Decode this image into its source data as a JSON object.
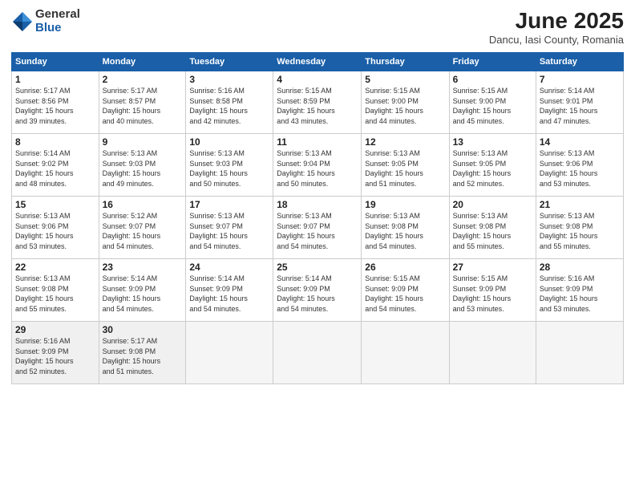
{
  "logo": {
    "general": "General",
    "blue": "Blue"
  },
  "title": "June 2025",
  "location": "Dancu, Iasi County, Romania",
  "weekdays": [
    "Sunday",
    "Monday",
    "Tuesday",
    "Wednesday",
    "Thursday",
    "Friday",
    "Saturday"
  ],
  "weeks": [
    [
      {
        "day": "1",
        "info": "Sunrise: 5:17 AM\nSunset: 8:56 PM\nDaylight: 15 hours\nand 39 minutes."
      },
      {
        "day": "2",
        "info": "Sunrise: 5:17 AM\nSunset: 8:57 PM\nDaylight: 15 hours\nand 40 minutes."
      },
      {
        "day": "3",
        "info": "Sunrise: 5:16 AM\nSunset: 8:58 PM\nDaylight: 15 hours\nand 42 minutes."
      },
      {
        "day": "4",
        "info": "Sunrise: 5:15 AM\nSunset: 8:59 PM\nDaylight: 15 hours\nand 43 minutes."
      },
      {
        "day": "5",
        "info": "Sunrise: 5:15 AM\nSunset: 9:00 PM\nDaylight: 15 hours\nand 44 minutes."
      },
      {
        "day": "6",
        "info": "Sunrise: 5:15 AM\nSunset: 9:00 PM\nDaylight: 15 hours\nand 45 minutes."
      },
      {
        "day": "7",
        "info": "Sunrise: 5:14 AM\nSunset: 9:01 PM\nDaylight: 15 hours\nand 47 minutes."
      }
    ],
    [
      {
        "day": "8",
        "info": "Sunrise: 5:14 AM\nSunset: 9:02 PM\nDaylight: 15 hours\nand 48 minutes."
      },
      {
        "day": "9",
        "info": "Sunrise: 5:13 AM\nSunset: 9:03 PM\nDaylight: 15 hours\nand 49 minutes."
      },
      {
        "day": "10",
        "info": "Sunrise: 5:13 AM\nSunset: 9:03 PM\nDaylight: 15 hours\nand 50 minutes."
      },
      {
        "day": "11",
        "info": "Sunrise: 5:13 AM\nSunset: 9:04 PM\nDaylight: 15 hours\nand 50 minutes."
      },
      {
        "day": "12",
        "info": "Sunrise: 5:13 AM\nSunset: 9:05 PM\nDaylight: 15 hours\nand 51 minutes."
      },
      {
        "day": "13",
        "info": "Sunrise: 5:13 AM\nSunset: 9:05 PM\nDaylight: 15 hours\nand 52 minutes."
      },
      {
        "day": "14",
        "info": "Sunrise: 5:13 AM\nSunset: 9:06 PM\nDaylight: 15 hours\nand 53 minutes."
      }
    ],
    [
      {
        "day": "15",
        "info": "Sunrise: 5:13 AM\nSunset: 9:06 PM\nDaylight: 15 hours\nand 53 minutes."
      },
      {
        "day": "16",
        "info": "Sunrise: 5:12 AM\nSunset: 9:07 PM\nDaylight: 15 hours\nand 54 minutes."
      },
      {
        "day": "17",
        "info": "Sunrise: 5:13 AM\nSunset: 9:07 PM\nDaylight: 15 hours\nand 54 minutes."
      },
      {
        "day": "18",
        "info": "Sunrise: 5:13 AM\nSunset: 9:07 PM\nDaylight: 15 hours\nand 54 minutes."
      },
      {
        "day": "19",
        "info": "Sunrise: 5:13 AM\nSunset: 9:08 PM\nDaylight: 15 hours\nand 54 minutes."
      },
      {
        "day": "20",
        "info": "Sunrise: 5:13 AM\nSunset: 9:08 PM\nDaylight: 15 hours\nand 55 minutes."
      },
      {
        "day": "21",
        "info": "Sunrise: 5:13 AM\nSunset: 9:08 PM\nDaylight: 15 hours\nand 55 minutes."
      }
    ],
    [
      {
        "day": "22",
        "info": "Sunrise: 5:13 AM\nSunset: 9:08 PM\nDaylight: 15 hours\nand 55 minutes."
      },
      {
        "day": "23",
        "info": "Sunrise: 5:14 AM\nSunset: 9:09 PM\nDaylight: 15 hours\nand 54 minutes."
      },
      {
        "day": "24",
        "info": "Sunrise: 5:14 AM\nSunset: 9:09 PM\nDaylight: 15 hours\nand 54 minutes."
      },
      {
        "day": "25",
        "info": "Sunrise: 5:14 AM\nSunset: 9:09 PM\nDaylight: 15 hours\nand 54 minutes."
      },
      {
        "day": "26",
        "info": "Sunrise: 5:15 AM\nSunset: 9:09 PM\nDaylight: 15 hours\nand 54 minutes."
      },
      {
        "day": "27",
        "info": "Sunrise: 5:15 AM\nSunset: 9:09 PM\nDaylight: 15 hours\nand 53 minutes."
      },
      {
        "day": "28",
        "info": "Sunrise: 5:16 AM\nSunset: 9:09 PM\nDaylight: 15 hours\nand 53 minutes."
      }
    ],
    [
      {
        "day": "29",
        "info": "Sunrise: 5:16 AM\nSunset: 9:09 PM\nDaylight: 15 hours\nand 52 minutes."
      },
      {
        "day": "30",
        "info": "Sunrise: 5:17 AM\nSunset: 9:08 PM\nDaylight: 15 hours\nand 51 minutes."
      },
      {
        "day": "",
        "info": ""
      },
      {
        "day": "",
        "info": ""
      },
      {
        "day": "",
        "info": ""
      },
      {
        "day": "",
        "info": ""
      },
      {
        "day": "",
        "info": ""
      }
    ]
  ]
}
